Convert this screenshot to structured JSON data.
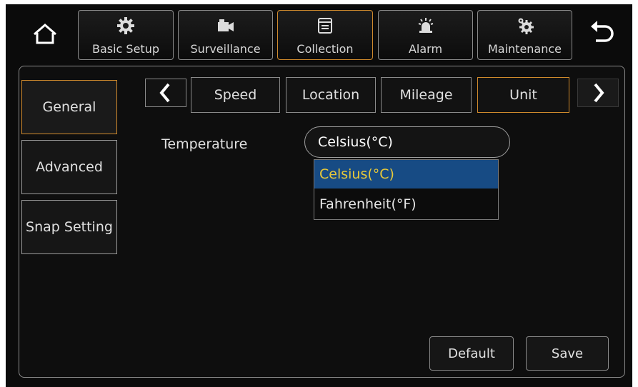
{
  "topbar": {
    "tabs": [
      {
        "label": "Basic Setup",
        "icon": "gear-icon"
      },
      {
        "label": "Surveillance",
        "icon": "camera-icon"
      },
      {
        "label": "Collection",
        "icon": "document-icon"
      },
      {
        "label": "Alarm",
        "icon": "alarm-light-icon"
      },
      {
        "label": "Maintenance",
        "icon": "gears-icon"
      }
    ],
    "active_tab": "Collection",
    "home_icon": "home-icon",
    "back_icon": "back-arrow-icon"
  },
  "sidebar": {
    "items": [
      {
        "label": "General"
      },
      {
        "label": "Advanced"
      },
      {
        "label": "Snap Setting"
      }
    ],
    "active_item": "General"
  },
  "subtabs": {
    "items": [
      {
        "label": "Speed"
      },
      {
        "label": "Location"
      },
      {
        "label": "Mileage"
      },
      {
        "label": "Unit"
      }
    ],
    "active_item": "Unit",
    "prev_icon": "chevron-left-icon",
    "next_icon": "chevron-right-icon"
  },
  "unit": {
    "temperature_label": "Temperature",
    "temperature_value": "Celsius(°C)",
    "options": [
      "Celsius(°C)",
      "Fahrenheit(°F)"
    ],
    "highlighted_option": "Celsius(°C)"
  },
  "actions": {
    "default_label": "Default",
    "save_label": "Save"
  },
  "colors": {
    "accent": "#d08a2c",
    "selection_bg": "#174b84",
    "selection_text": "#e8c93a",
    "background": "#0b0b0b"
  }
}
